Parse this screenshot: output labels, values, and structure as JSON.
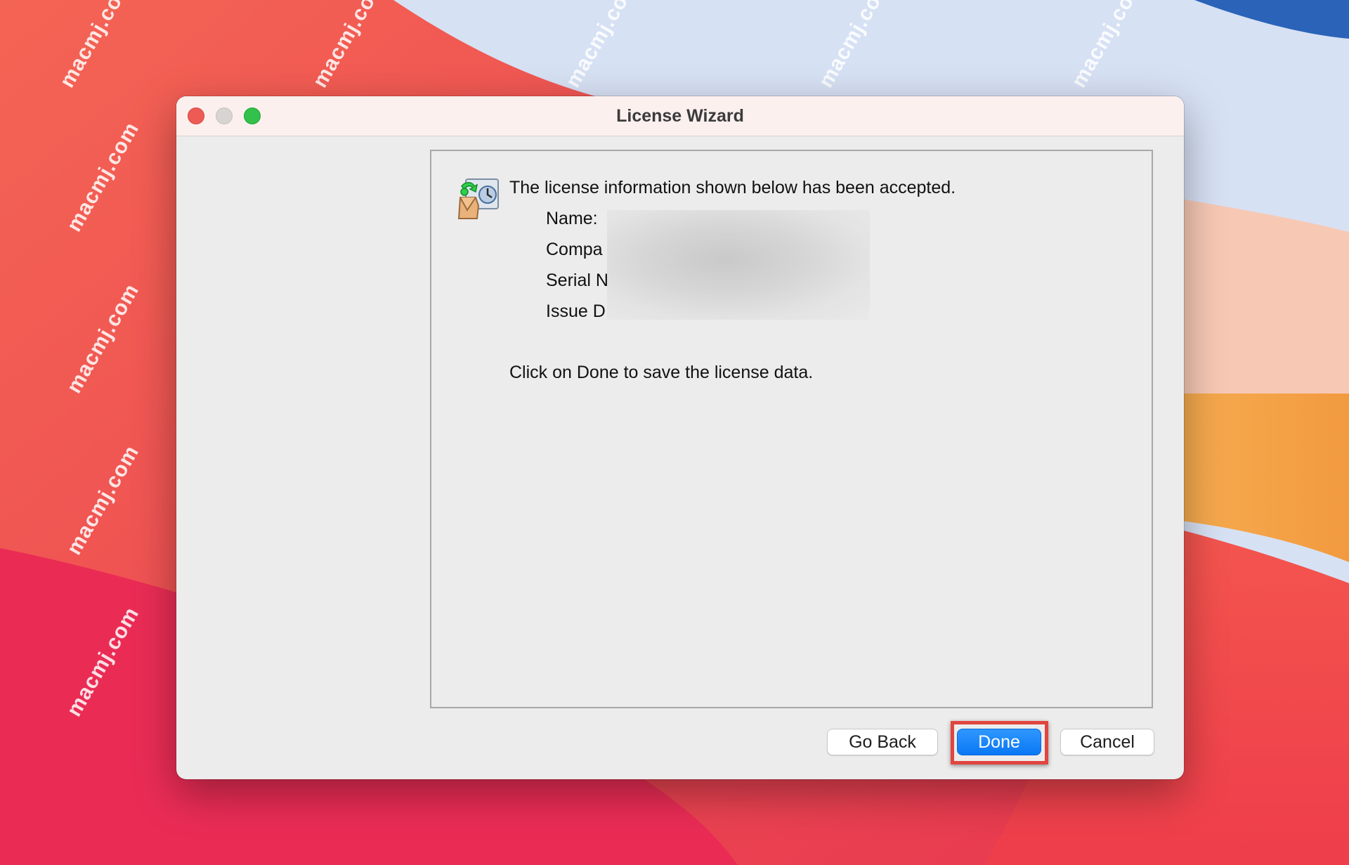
{
  "window": {
    "title": "License Wizard"
  },
  "content": {
    "message": "The license information shown below has been accepted.",
    "fields": [
      {
        "label": "Name:"
      },
      {
        "label": "Compa"
      },
      {
        "label": "Serial N"
      },
      {
        "label": "Issue D"
      }
    ],
    "instruction": "Click on Done to save the license data."
  },
  "buttons": {
    "go_back": "Go Back",
    "done": "Done",
    "cancel": "Cancel"
  },
  "watermark": {
    "text": "macmj.com"
  },
  "colors": {
    "accent_blue": "#0a78f5",
    "highlight_red": "#e0453f",
    "close": "#ee5b55",
    "maximize": "#32c14a"
  }
}
